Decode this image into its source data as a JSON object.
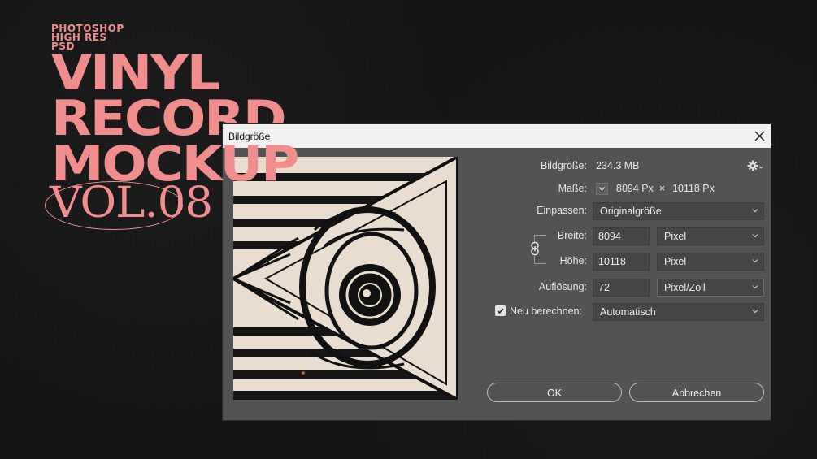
{
  "poster": {
    "line1": "PHOTOSHOP",
    "line2": "HIGH RES PSD",
    "title1": "VINYL",
    "title2": "RECORD",
    "title3": "MOCKUP",
    "vol": "VOL.08"
  },
  "dialog": {
    "title": "Bildgröße",
    "image_size_label": "Bildgröße:",
    "image_size_value": "234.3 MB",
    "dimensions_label": "Maße:",
    "dim_width": "8094 Px",
    "dim_x": "×",
    "dim_height": "10118 Px",
    "fit_label": "Einpassen:",
    "fit_value": "Originalgröße",
    "width_label": "Breite:",
    "width_value": "8094",
    "width_unit": "Pixel",
    "height_label": "Höhe:",
    "height_value": "10118",
    "height_unit": "Pixel",
    "resolution_label": "Auflösung:",
    "resolution_value": "72",
    "resolution_unit": "Pixel/Zoll",
    "resample_label": "Neu berechnen:",
    "resample_checked": true,
    "resample_value": "Automatisch",
    "ok_label": "OK",
    "cancel_label": "Abbrechen"
  },
  "icons": [
    "close-icon",
    "gear-icon",
    "chevron-down-icon",
    "link-icon",
    "checkmark-icon"
  ]
}
